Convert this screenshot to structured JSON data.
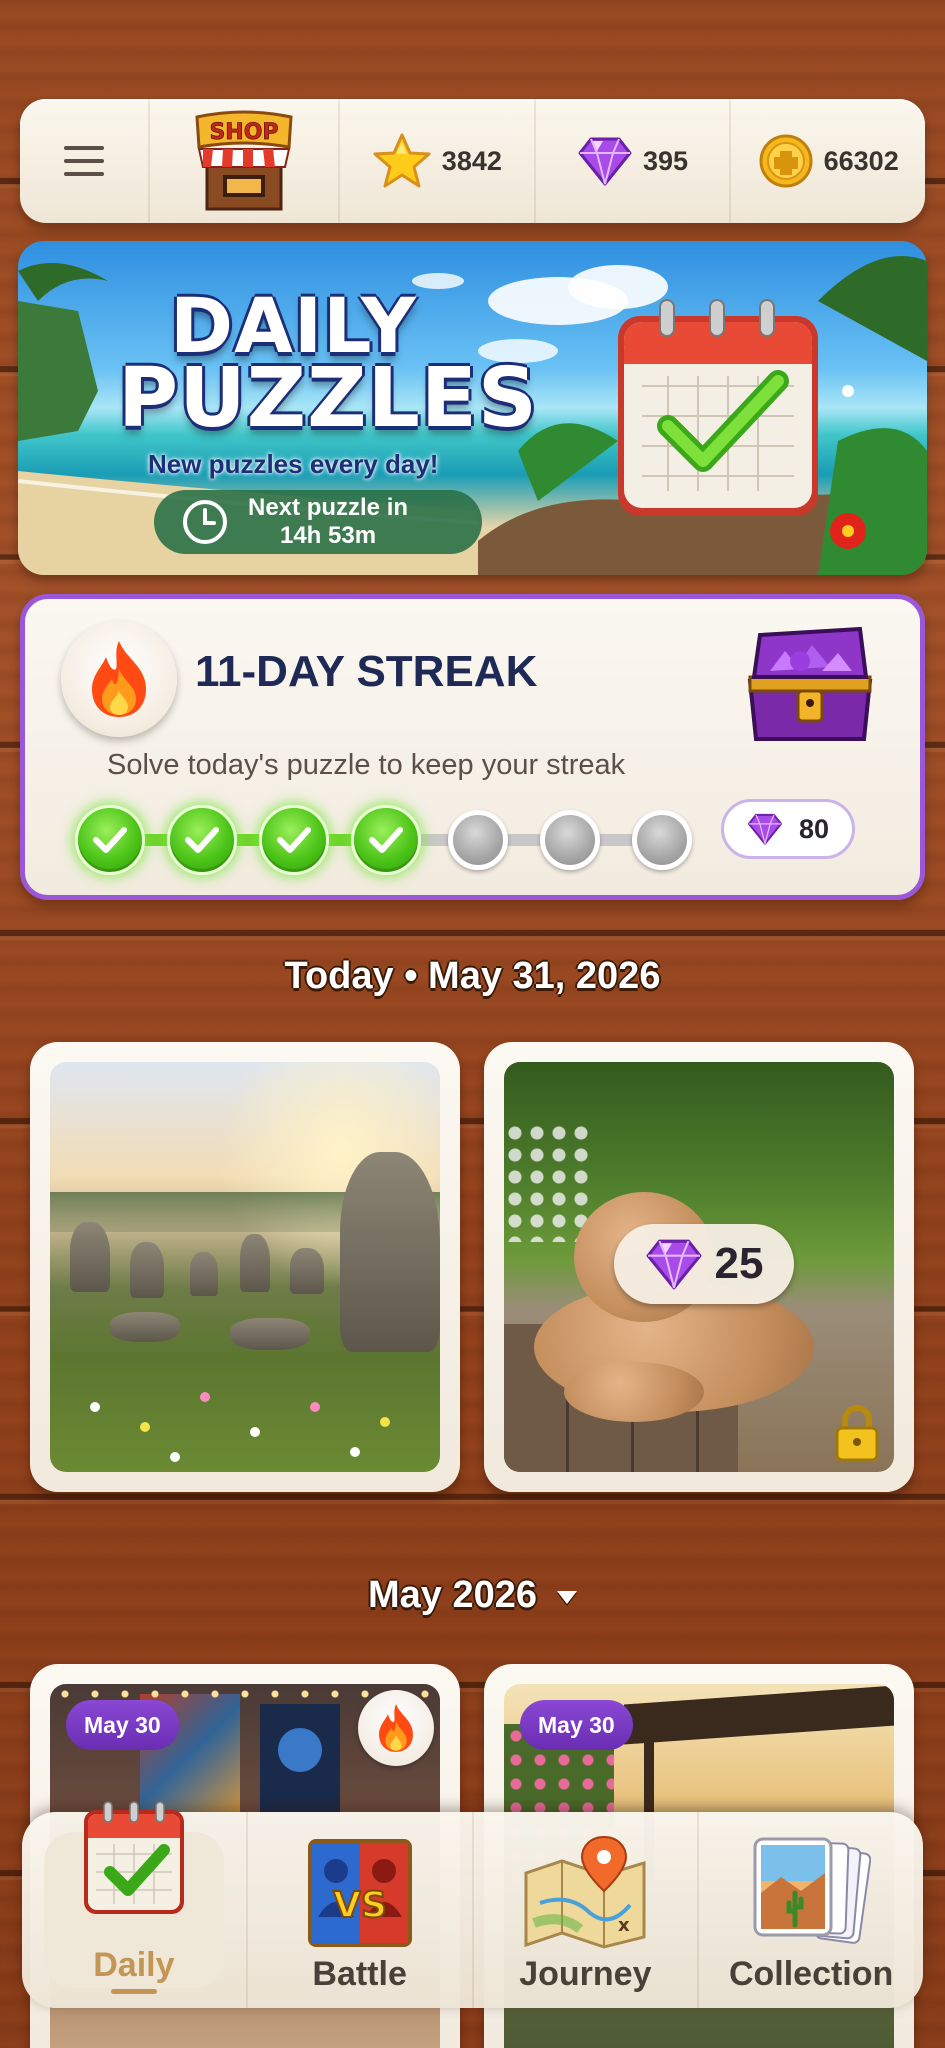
{
  "topbar": {
    "menu_icon": "hamburger-menu-icon",
    "shop_label": "SHOP",
    "stars": "3842",
    "gems": "395",
    "coins": "66302"
  },
  "hero": {
    "title_line1": "DAILY",
    "title_line2": "PUZZLES",
    "subtitle": "New puzzles every day!",
    "timer_line1": "Next puzzle in",
    "timer_line2": "14h 53m"
  },
  "streak": {
    "title": "11-DAY STREAK",
    "subtitle": "Solve today's puzzle to keep your streak",
    "days_completed": 4,
    "days_total": 7,
    "reward_gems": "80"
  },
  "today": {
    "heading": "Today • May 31, 2026",
    "puzzles": [
      {
        "name": "standing-stones",
        "locked": false
      },
      {
        "name": "poodle",
        "locked": true,
        "price": "25"
      }
    ]
  },
  "month": {
    "heading": "May 2026",
    "puzzles": [
      {
        "date": "May 30",
        "completed_streak": true
      },
      {
        "date": "May 30",
        "completed_streak": false
      }
    ]
  },
  "nav": {
    "items": [
      {
        "label": "Daily",
        "icon": "calendar-check-icon",
        "active": true
      },
      {
        "label": "Battle",
        "icon": "versus-icon",
        "active": false
      },
      {
        "label": "Journey",
        "icon": "map-pin-icon",
        "active": false
      },
      {
        "label": "Collection",
        "icon": "cards-stack-icon",
        "active": false
      }
    ]
  },
  "colors": {
    "accent_purple": "#9a58d8",
    "streak_green": "#4cc418",
    "wood": "#9a4a22"
  }
}
